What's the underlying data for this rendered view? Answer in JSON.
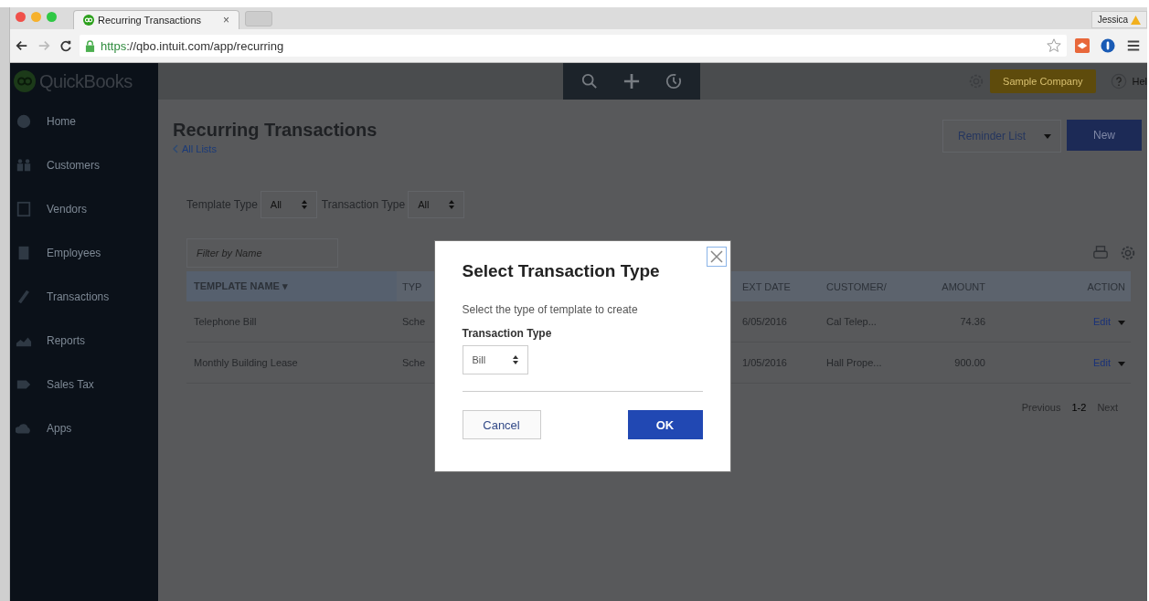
{
  "browser": {
    "tab_title": "Recurring Transactions",
    "tab_close": "×",
    "url_scheme": "https",
    "url_rest": "://qbo.intuit.com/app/recurring",
    "profile": "Jessica"
  },
  "app": {
    "logo": "QuickBooks",
    "sample_company": "Sample Company",
    "help": "Hel"
  },
  "sidebar": {
    "items": [
      {
        "label": "Home",
        "kind": "home"
      },
      {
        "label": "Customers",
        "kind": "customers"
      },
      {
        "label": "Vendors",
        "kind": "vendors"
      },
      {
        "label": "Employees",
        "kind": "employees"
      },
      {
        "label": "Transactions",
        "kind": "transactions"
      },
      {
        "label": "Reports",
        "kind": "reports"
      },
      {
        "label": "Sales Tax",
        "kind": "tax"
      },
      {
        "label": "Apps",
        "kind": "apps"
      }
    ]
  },
  "page": {
    "title": "Recurring Transactions",
    "back_link": "All Lists",
    "reminder_list": "Reminder List",
    "new_button": "New",
    "filters": [
      {
        "label": "Template Type",
        "value": "All"
      },
      {
        "label": "Transaction Type",
        "value": "All"
      }
    ],
    "search": {
      "placeholder": "Filter by Name"
    }
  },
  "table": {
    "columns": [
      "TEMPLATE NAME ▾",
      "TYP",
      "EXT DATE",
      "CUSTOMER/",
      "AMOUNT",
      "ACTION"
    ],
    "rows": [
      {
        "name": "Telephone Bill",
        "type": "Sche",
        "date": "6/05/2016",
        "customer": "Cal Telep...",
        "amount": "74.36",
        "action": "Edit"
      },
      {
        "name": "Monthly Building Lease",
        "type": "Sche",
        "date": "1/05/2016",
        "customer": "Hall Prope...",
        "amount": "900.00",
        "action": "Edit"
      }
    ]
  },
  "pagination": {
    "previous": "Previous",
    "range": "1-2",
    "next": "Next"
  },
  "dialog": {
    "title": "Select Transaction Type",
    "description": "Select the type of template to create",
    "field_label": "Transaction Type",
    "value": "Bill",
    "cancel": "Cancel",
    "ok": "OK"
  }
}
